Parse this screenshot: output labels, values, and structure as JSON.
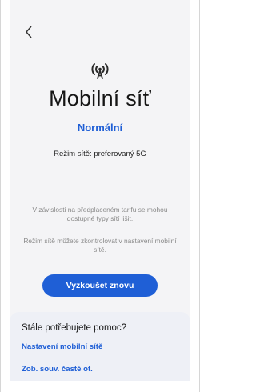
{
  "header": {
    "back_icon": "chevron-left-icon"
  },
  "hero": {
    "icon": "signal-tower-icon",
    "title": "Mobilní síť",
    "status": "Normální",
    "mode_text": "Režim sítě: preferovaný 5G"
  },
  "info": {
    "line1": "V závislosti na předplaceném tarifu se mohou dostupné typy sítí lišit.",
    "line2": "Režim sítě můžete zkontrolovat v nastavení mobilní sítě."
  },
  "actions": {
    "retry_label": "Vyzkoušet znovu"
  },
  "help": {
    "title": "Stále potřebujete pomoc?",
    "link_settings": "Nastavení mobilní sítě",
    "link_faq": "Zob. souv. časté ot."
  },
  "colors": {
    "accent": "#1f5fd6",
    "background": "#f4f4f6",
    "help_panel": "#eef0f6"
  }
}
